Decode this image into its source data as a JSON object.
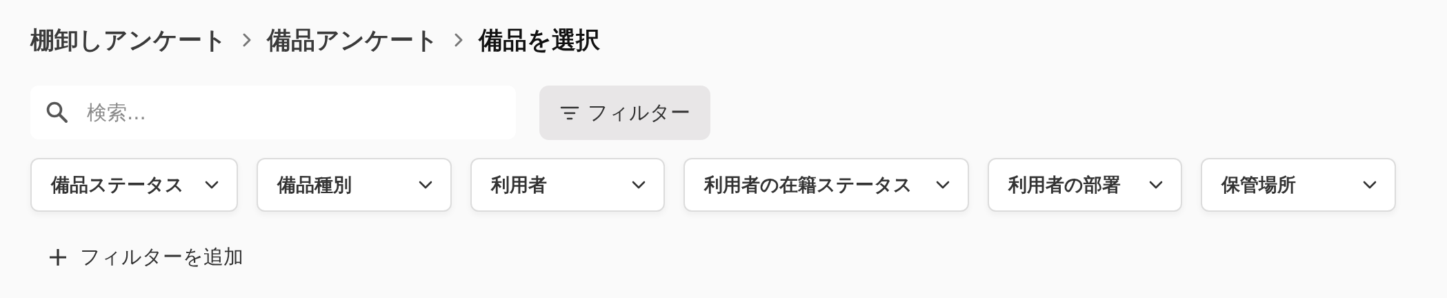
{
  "breadcrumb": [
    {
      "label": "棚卸しアンケート",
      "current": false
    },
    {
      "label": "備品アンケート",
      "current": false
    },
    {
      "label": "備品を選択",
      "current": true
    }
  ],
  "search": {
    "placeholder": "検索..."
  },
  "filter_button": {
    "label": "フィルター"
  },
  "filters": [
    {
      "label": "備品ステータス"
    },
    {
      "label": "備品種別"
    },
    {
      "label": "利用者"
    },
    {
      "label": "利用者の在籍ステータス"
    },
    {
      "label": "利用者の部署"
    },
    {
      "label": "保管場所"
    }
  ],
  "add_filter": {
    "label": "フィルターを追加"
  }
}
